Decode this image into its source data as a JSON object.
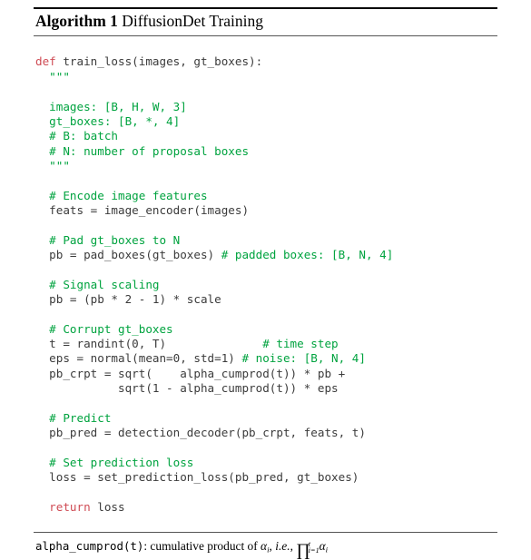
{
  "algorithm": {
    "label": "Algorithm 1",
    "subject": "DiffusionDet Training",
    "rules": {
      "top_color": "#000000",
      "mid_color": "#555555",
      "bottom_color": "#555555"
    },
    "code": {
      "colors": {
        "keyword": "#cf4b54",
        "comment": "#00a33f",
        "code": "#3b3b3b"
      },
      "lines": [
        [
          {
            "t": "def",
            "c": "kw"
          },
          {
            "t": " train_loss(images, gt_boxes):",
            "c": "cd"
          }
        ],
        [
          {
            "t": "  \"\"\"",
            "c": "cm"
          }
        ],
        [
          {
            "t": "",
            "c": "cd"
          }
        ],
        [
          {
            "t": "  images: [B, H, W, 3]",
            "c": "cm"
          }
        ],
        [
          {
            "t": "  gt_boxes: [B, *, 4]",
            "c": "cm"
          }
        ],
        [
          {
            "t": "  # B: batch",
            "c": "cm"
          }
        ],
        [
          {
            "t": "  # N: number of proposal boxes",
            "c": "cm"
          }
        ],
        [
          {
            "t": "  \"\"\"",
            "c": "cm"
          }
        ],
        [
          {
            "t": "",
            "c": "cd"
          }
        ],
        [
          {
            "t": "  # Encode image features",
            "c": "cm"
          }
        ],
        [
          {
            "t": "  feats = image_encoder(images)",
            "c": "cd"
          }
        ],
        [
          {
            "t": "",
            "c": "cd"
          }
        ],
        [
          {
            "t": "  # Pad gt_boxes to N",
            "c": "cm"
          }
        ],
        [
          {
            "t": "  pb = pad_boxes(gt_boxes) ",
            "c": "cd"
          },
          {
            "t": "# padded boxes: [B, N, 4]",
            "c": "cm"
          }
        ],
        [
          {
            "t": "",
            "c": "cd"
          }
        ],
        [
          {
            "t": "  # Signal scaling",
            "c": "cm"
          }
        ],
        [
          {
            "t": "  pb = (pb * 2 - 1) * scale",
            "c": "cd"
          }
        ],
        [
          {
            "t": "",
            "c": "cd"
          }
        ],
        [
          {
            "t": "  # Corrupt gt_boxes",
            "c": "cm"
          }
        ],
        [
          {
            "t": "  t = randint(0, T)              ",
            "c": "cd"
          },
          {
            "t": "# time step",
            "c": "cm"
          }
        ],
        [
          {
            "t": "  eps = normal(mean=0, std=1) ",
            "c": "cd"
          },
          {
            "t": "# noise: [B, N, 4]",
            "c": "cm"
          }
        ],
        [
          {
            "t": "  pb_crpt = sqrt(    alpha_cumprod(t)) * pb +",
            "c": "cd"
          }
        ],
        [
          {
            "t": "            sqrt(1 - alpha_cumprod(t)) * eps",
            "c": "cd"
          }
        ],
        [
          {
            "t": "",
            "c": "cd"
          }
        ],
        [
          {
            "t": "  # Predict",
            "c": "cm"
          }
        ],
        [
          {
            "t": "  pb_pred = detection_decoder(pb_crpt, feats, t)",
            "c": "cd"
          }
        ],
        [
          {
            "t": "",
            "c": "cd"
          }
        ],
        [
          {
            "t": "  # Set prediction loss",
            "c": "cm"
          }
        ],
        [
          {
            "t": "  loss = set_prediction_loss(pb_pred, gt_boxes)",
            "c": "cd"
          }
        ],
        [
          {
            "t": "",
            "c": "cd"
          }
        ],
        [
          {
            "t": "  ",
            "c": "cd"
          },
          {
            "t": "return",
            "c": "kw"
          },
          {
            "t": " loss",
            "c": "cd"
          }
        ]
      ]
    },
    "footnote": {
      "mono_term": "alpha_cumprod(t)",
      "text_before": ": cumulative product of ",
      "symbol": "α",
      "symbol_sub": "i",
      "ie": "i.e.",
      "comma": ", ",
      "product_symbol": "∏",
      "product_upper": "t",
      "product_lower": "i=1",
      "product_operand": "α",
      "product_operand_sub": "i"
    }
  }
}
